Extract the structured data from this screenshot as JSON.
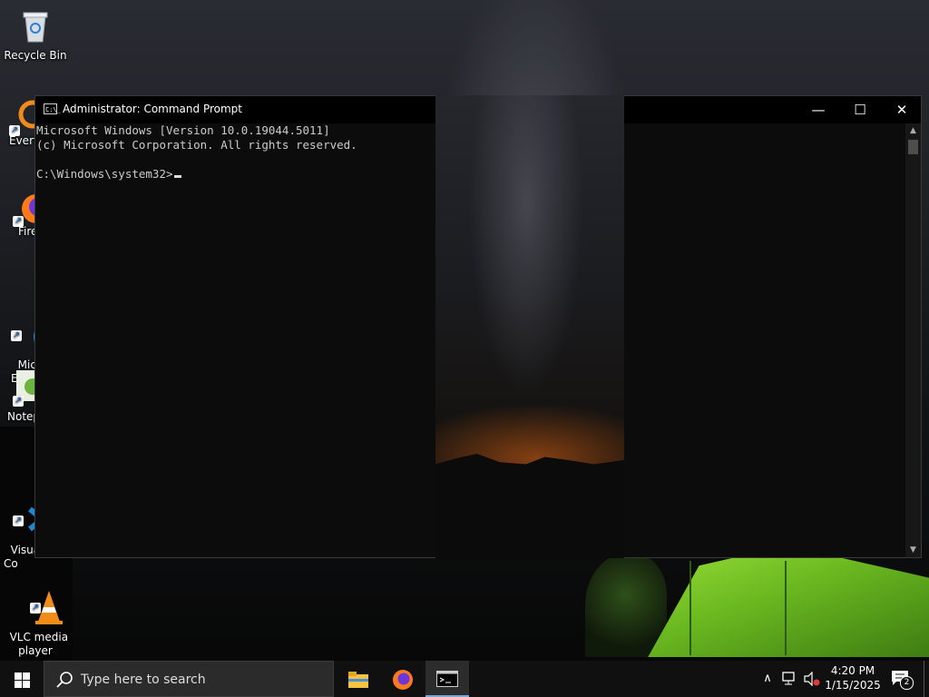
{
  "desktop": {
    "icons": [
      {
        "label": "Recycle Bin"
      },
      {
        "label": "Every"
      },
      {
        "label": "Fire"
      },
      {
        "label": "Micro\nEd"
      },
      {
        "label": "Notep"
      },
      {
        "label": "Visual\nCo"
      },
      {
        "label": "VLC media\nplayer"
      }
    ]
  },
  "window": {
    "title": "Administrator: Command Prompt",
    "icon_label": "C:\\_",
    "buttons": {
      "minimize": "—",
      "maximize": "☐",
      "close": "✕"
    },
    "console_lines": [
      "Microsoft Windows [Version 10.0.19044.5011]",
      "(c) Microsoft Corporation. All rights reserved.",
      "",
      "C:\\Windows\\system32>"
    ]
  },
  "taskbar": {
    "search_placeholder": "Type here to search",
    "tray": {
      "chevron": "∧",
      "time": "4:20 PM",
      "date": "1/15/2025",
      "notification_count": "2"
    }
  },
  "colors": {
    "taskbar_bg": "#101010",
    "console_bg": "#0c0c0c",
    "console_text": "#cccccc",
    "accent": "#7aa7d6"
  }
}
